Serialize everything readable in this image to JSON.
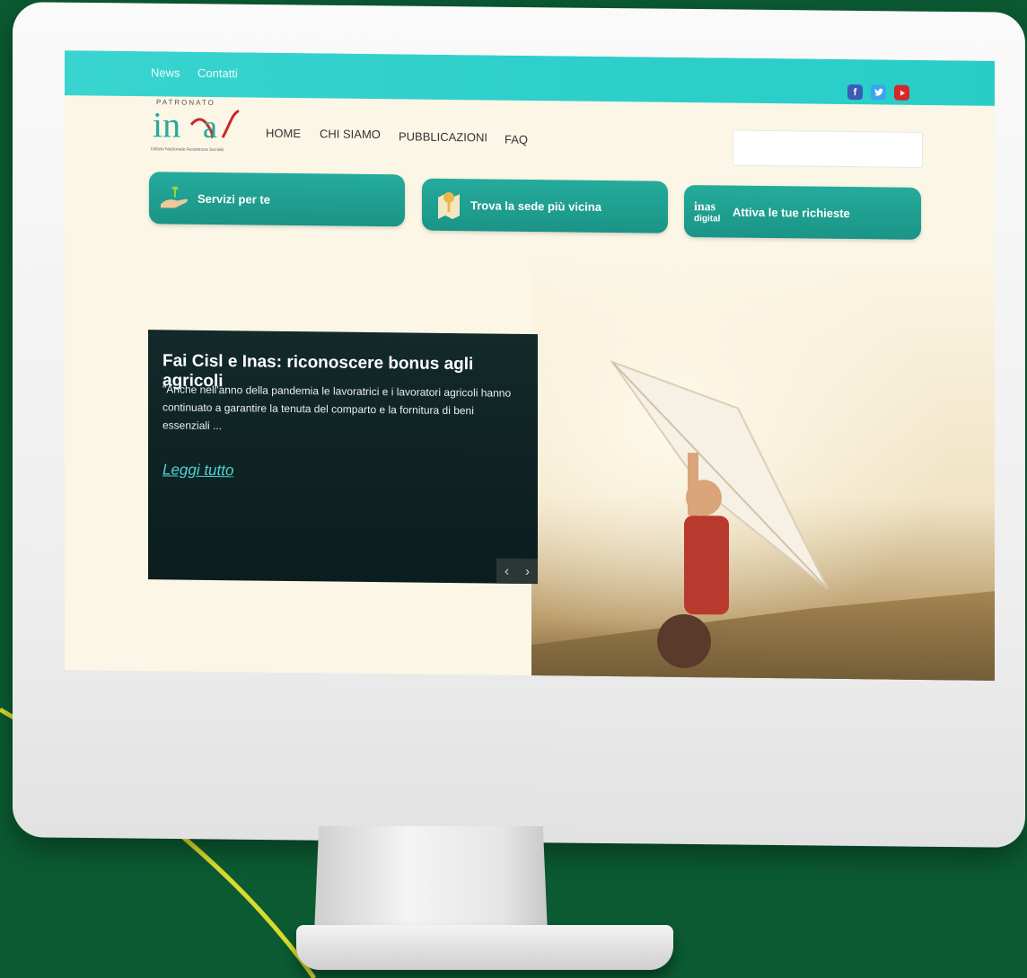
{
  "topbar": {
    "links": [
      "News",
      "Contatti"
    ],
    "social": [
      "facebook-icon",
      "twitter-icon",
      "youtube-icon"
    ]
  },
  "logo": {
    "small_text": "PATRONATO",
    "brand": "inas",
    "tagline": "Istituto Nazionale Assistenza Sociale"
  },
  "nav": {
    "items": [
      "HOME",
      "CHI SIAMO",
      "PUBBLICAZIONI",
      "FAQ"
    ]
  },
  "search": {
    "placeholder": ""
  },
  "services": [
    {
      "label": "Servizi per te",
      "icon": "hand-plant-icon"
    },
    {
      "label": "Trova la sede più vicina",
      "icon": "map-pin-icon"
    },
    {
      "label": "Attiva le tue richieste",
      "icon": "inas-digital-logo"
    }
  ],
  "hero": {
    "title": "Fai Cisl e Inas: riconoscere bonus agli agricoli",
    "excerpt": "\"Anche nell'anno della pandemia le lavoratrici e i lavoratori agricoli hanno continuato a garantire la tenuta del comparto e la fornitura di beni essenziali ...",
    "read_more": "Leggi tutto",
    "prev": "‹",
    "next": "›"
  },
  "colors": {
    "background": "#0b5a32",
    "topbar": "#2fcfcb",
    "accent_green": "#1f9f90",
    "logo_red": "#c8282c",
    "arc_yellow": "#d9dc2e"
  }
}
